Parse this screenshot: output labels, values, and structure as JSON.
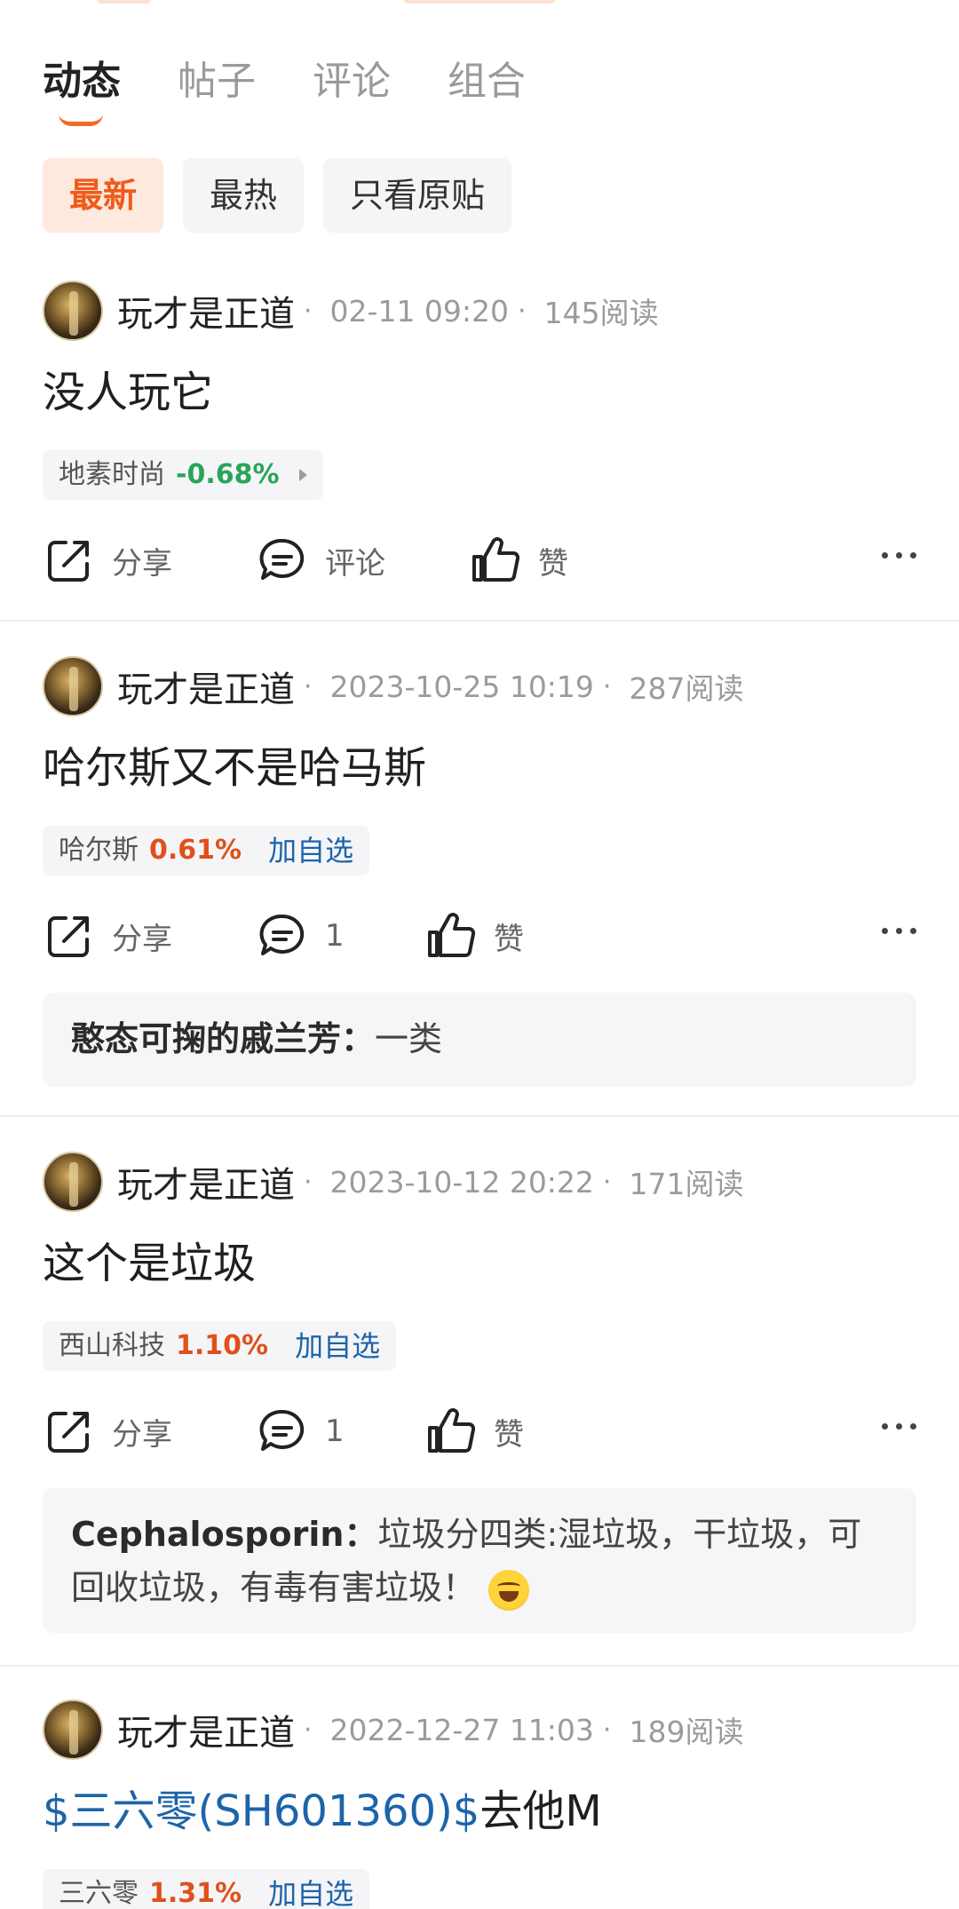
{
  "tabs": [
    {
      "label": "动态",
      "active": true
    },
    {
      "label": "帖子",
      "active": false
    },
    {
      "label": "评论",
      "active": false
    },
    {
      "label": "组合",
      "active": false
    }
  ],
  "filters": [
    {
      "label": "最新",
      "active": true
    },
    {
      "label": "最热",
      "active": false
    },
    {
      "label": "只看原贴",
      "active": false
    }
  ],
  "labels": {
    "share": "分享",
    "comment": "评论",
    "like": "赞",
    "add_watch": "加自选"
  },
  "colors": {
    "accent": "#f36a21",
    "up": "#e0501c",
    "down": "#28a55a",
    "link": "#1d64a9"
  },
  "posts": [
    {
      "user": "玩才是正道",
      "time": "02-11 09:20",
      "reads": "145阅读",
      "text": "没人玩它",
      "stock": {
        "name": "地素时尚",
        "change": "-0.68%"
      },
      "comment_count": ""
    },
    {
      "user": "玩才是正道",
      "time": "2023-10-25 10:19",
      "reads": "287阅读",
      "text": "哈尔斯又不是哈马斯",
      "stock": {
        "name": "哈尔斯",
        "change": "0.61%"
      },
      "comment_count": "1",
      "reply": {
        "author": "憨态可掬的戚兰芳：",
        "text": "一类"
      }
    },
    {
      "user": "玩才是正道",
      "time": "2023-10-12 20:22",
      "reads": "171阅读",
      "text": "这个是垃圾",
      "stock": {
        "name": "西山科技",
        "change": "1.10%"
      },
      "comment_count": "1",
      "reply": {
        "author": "Cephalosporin：",
        "text": "垃圾分四类:湿垃圾，干垃圾，可回收垃圾，有毒有害垃圾！",
        "emoji": "laughing-crying-emoji"
      }
    },
    {
      "user": "玩才是正道",
      "time": "2022-12-27 11:03",
      "reads": "189阅读",
      "text_link": "$三六零(SH601360)$",
      "text": "去他M",
      "stock": {
        "name": "三六零",
        "change": "1.31%"
      }
    }
  ]
}
